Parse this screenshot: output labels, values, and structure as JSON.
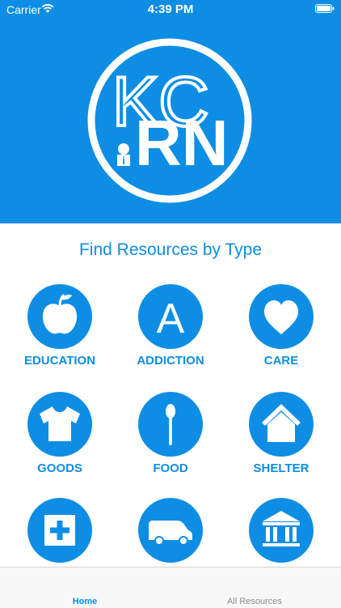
{
  "status_bar": {
    "carrier": "Carrier",
    "time": "4:39 PM"
  },
  "logo": {
    "top_text": "KC",
    "bottom_text": "RN",
    "badge_letter": "i"
  },
  "section_title": "Find Resources by Type",
  "categories": [
    {
      "label": "EDUCATION",
      "icon": "apple-icon"
    },
    {
      "label": "ADDICTION",
      "icon": "letter-a-icon",
      "glyph": "A"
    },
    {
      "label": "CARE",
      "icon": "heart-icon"
    },
    {
      "label": "GOODS",
      "icon": "tshirt-icon"
    },
    {
      "label": "FOOD",
      "icon": "spoon-icon"
    },
    {
      "label": "SHELTER",
      "icon": "house-icon"
    },
    {
      "label": "",
      "icon": "medical-cross-icon"
    },
    {
      "label": "",
      "icon": "van-icon"
    },
    {
      "label": "",
      "icon": "government-building-icon"
    }
  ],
  "tab_bar": {
    "home_label": "Home",
    "all_resources_label": "All Resources"
  },
  "colors": {
    "accent": "#0d8ee4",
    "background": "#ffffff",
    "tab_bar": "#f7f7f7"
  }
}
